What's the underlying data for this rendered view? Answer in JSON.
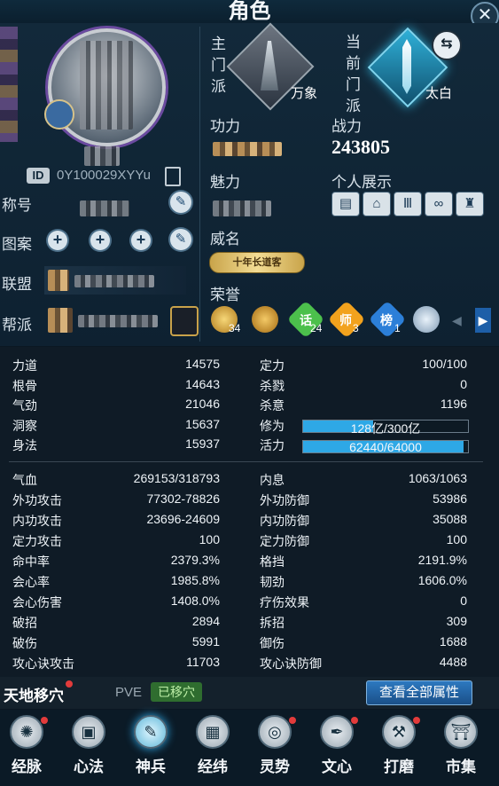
{
  "header": {
    "title": "角色"
  },
  "profile": {
    "id_prefix": "ID",
    "id_value": "0Y100029XYYu",
    "rows": {
      "title_label": "称号",
      "pattern_label": "图案",
      "alliance_label": "联盟",
      "guild_label": "帮派"
    }
  },
  "sect": {
    "main_label": "主门派",
    "main_value": "万象",
    "current_label": "当前门派",
    "current_value": "太白"
  },
  "info": {
    "gongli_label": "功力",
    "zhanli_label": "战力",
    "zhanli_value": "243805",
    "meili_label": "魅力",
    "personal_label": "个人展示",
    "weiming_label": "威名",
    "weiming_badge": "十年长道客",
    "honor_label": "荣誉",
    "honor_counts": [
      "34",
      "24",
      "3",
      "1"
    ],
    "honor_chars": [
      "话",
      "师",
      "榜"
    ]
  },
  "stats_a": [
    {
      "k": "力道",
      "v": "14575",
      "k2": "定力",
      "v2": "100/100"
    },
    {
      "k": "根骨",
      "v": "14643",
      "k2": "杀戮",
      "v2": "0"
    },
    {
      "k": "气劲",
      "v": "21046",
      "k2": "杀意",
      "v2": "1196"
    },
    {
      "k": "洞察",
      "v": "15637",
      "k2": "修为"
    },
    {
      "k": "身法",
      "v": "15937",
      "k2": "活力"
    }
  ],
  "bars": {
    "xiuwei": {
      "text": "128亿/300亿",
      "fraction": 0.4267
    },
    "huoli": {
      "text": "62440/64000",
      "fraction": 0.9756
    }
  },
  "stats_b": [
    {
      "k": "气血",
      "v": "269153/318793",
      "k2": "内息",
      "v2": "1063/1063"
    },
    {
      "k": "外功攻击",
      "v": "77302-78826",
      "k2": "外功防御",
      "v2": "53986"
    },
    {
      "k": "内功攻击",
      "v": "23696-24609",
      "k2": "内功防御",
      "v2": "35088"
    },
    {
      "k": "定力攻击",
      "v": "100",
      "k2": "定力防御",
      "v2": "100"
    },
    {
      "k": "命中率",
      "v": "2379.3%",
      "k2": "格挡",
      "v2": "2191.9%"
    },
    {
      "k": "会心率",
      "v": "1985.8%",
      "k2": "韧劲",
      "v2": "1606.0%"
    },
    {
      "k": "会心伤害",
      "v": "1408.0%",
      "k2": "疗伤效果",
      "v2": "0"
    },
    {
      "k": "破招",
      "v": "2894",
      "k2": "拆招",
      "v2": "309"
    },
    {
      "k": "破伤",
      "v": "5991",
      "k2": "御伤",
      "v2": "1688"
    },
    {
      "k": "攻心诀攻击",
      "v": "11703",
      "k2": "攻心诀防御",
      "v2": "4488"
    }
  ],
  "strip": {
    "tiandi": "天地移穴",
    "pve": "PVE",
    "moved": "已移穴",
    "view_all": "查看全部属性"
  },
  "nav": [
    {
      "label": "经脉",
      "icon": "meridian-icon",
      "glyph": "✺"
    },
    {
      "label": "心法",
      "icon": "scroll-icon",
      "glyph": "▣"
    },
    {
      "label": "神兵",
      "icon": "weapon-icon",
      "glyph": "✎"
    },
    {
      "label": "经纬",
      "icon": "grid-icon",
      "glyph": "▦"
    },
    {
      "label": "灵势",
      "icon": "spirit-icon",
      "glyph": "◎"
    },
    {
      "label": "文心",
      "icon": "brush-icon",
      "glyph": "✒"
    },
    {
      "label": "打磨",
      "icon": "hammer-icon",
      "glyph": "⚒"
    },
    {
      "label": "市集",
      "icon": "market-icon",
      "glyph": "⛩"
    }
  ],
  "colors": {
    "accent": "#2ea8e6",
    "red_dot": "#e23b3b",
    "gold": "#e5b54a"
  }
}
